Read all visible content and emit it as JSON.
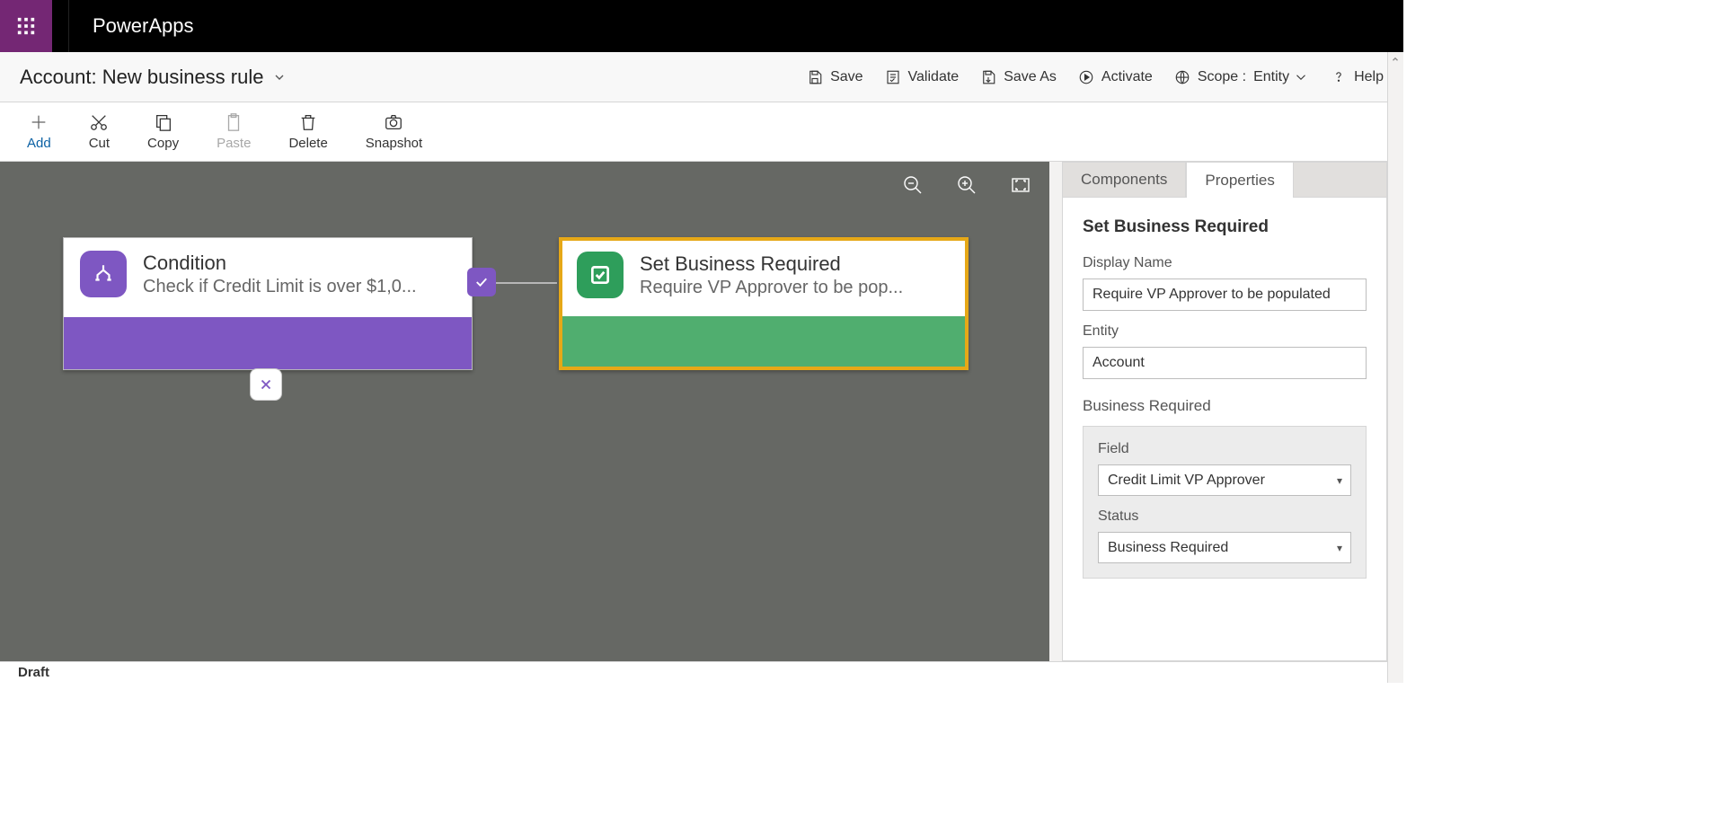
{
  "app": {
    "name": "PowerApps"
  },
  "title": {
    "prefix": "Account:",
    "name": "New business rule"
  },
  "header_actions": {
    "save": "Save",
    "validate": "Validate",
    "save_as": "Save As",
    "activate": "Activate",
    "scope_label": "Scope :",
    "scope_value": "Entity",
    "help": "Help"
  },
  "toolbar": {
    "add": "Add",
    "cut": "Cut",
    "copy": "Copy",
    "paste": "Paste",
    "delete": "Delete",
    "snapshot": "Snapshot"
  },
  "canvas": {
    "condition": {
      "title": "Condition",
      "subtitle": "Check if Credit Limit is over $1,0..."
    },
    "action": {
      "title": "Set Business Required",
      "subtitle": "Require VP Approver to be pop..."
    }
  },
  "panel": {
    "tabs": {
      "components": "Components",
      "properties": "Properties"
    },
    "heading": "Set Business Required",
    "display_name_label": "Display Name",
    "display_name_value": "Require VP Approver to be populated",
    "entity_label": "Entity",
    "entity_value": "Account",
    "section_label": "Business Required",
    "field_label": "Field",
    "field_value": "Credit Limit VP Approver",
    "status_label": "Status",
    "status_value": "Business Required"
  },
  "status": "Draft"
}
